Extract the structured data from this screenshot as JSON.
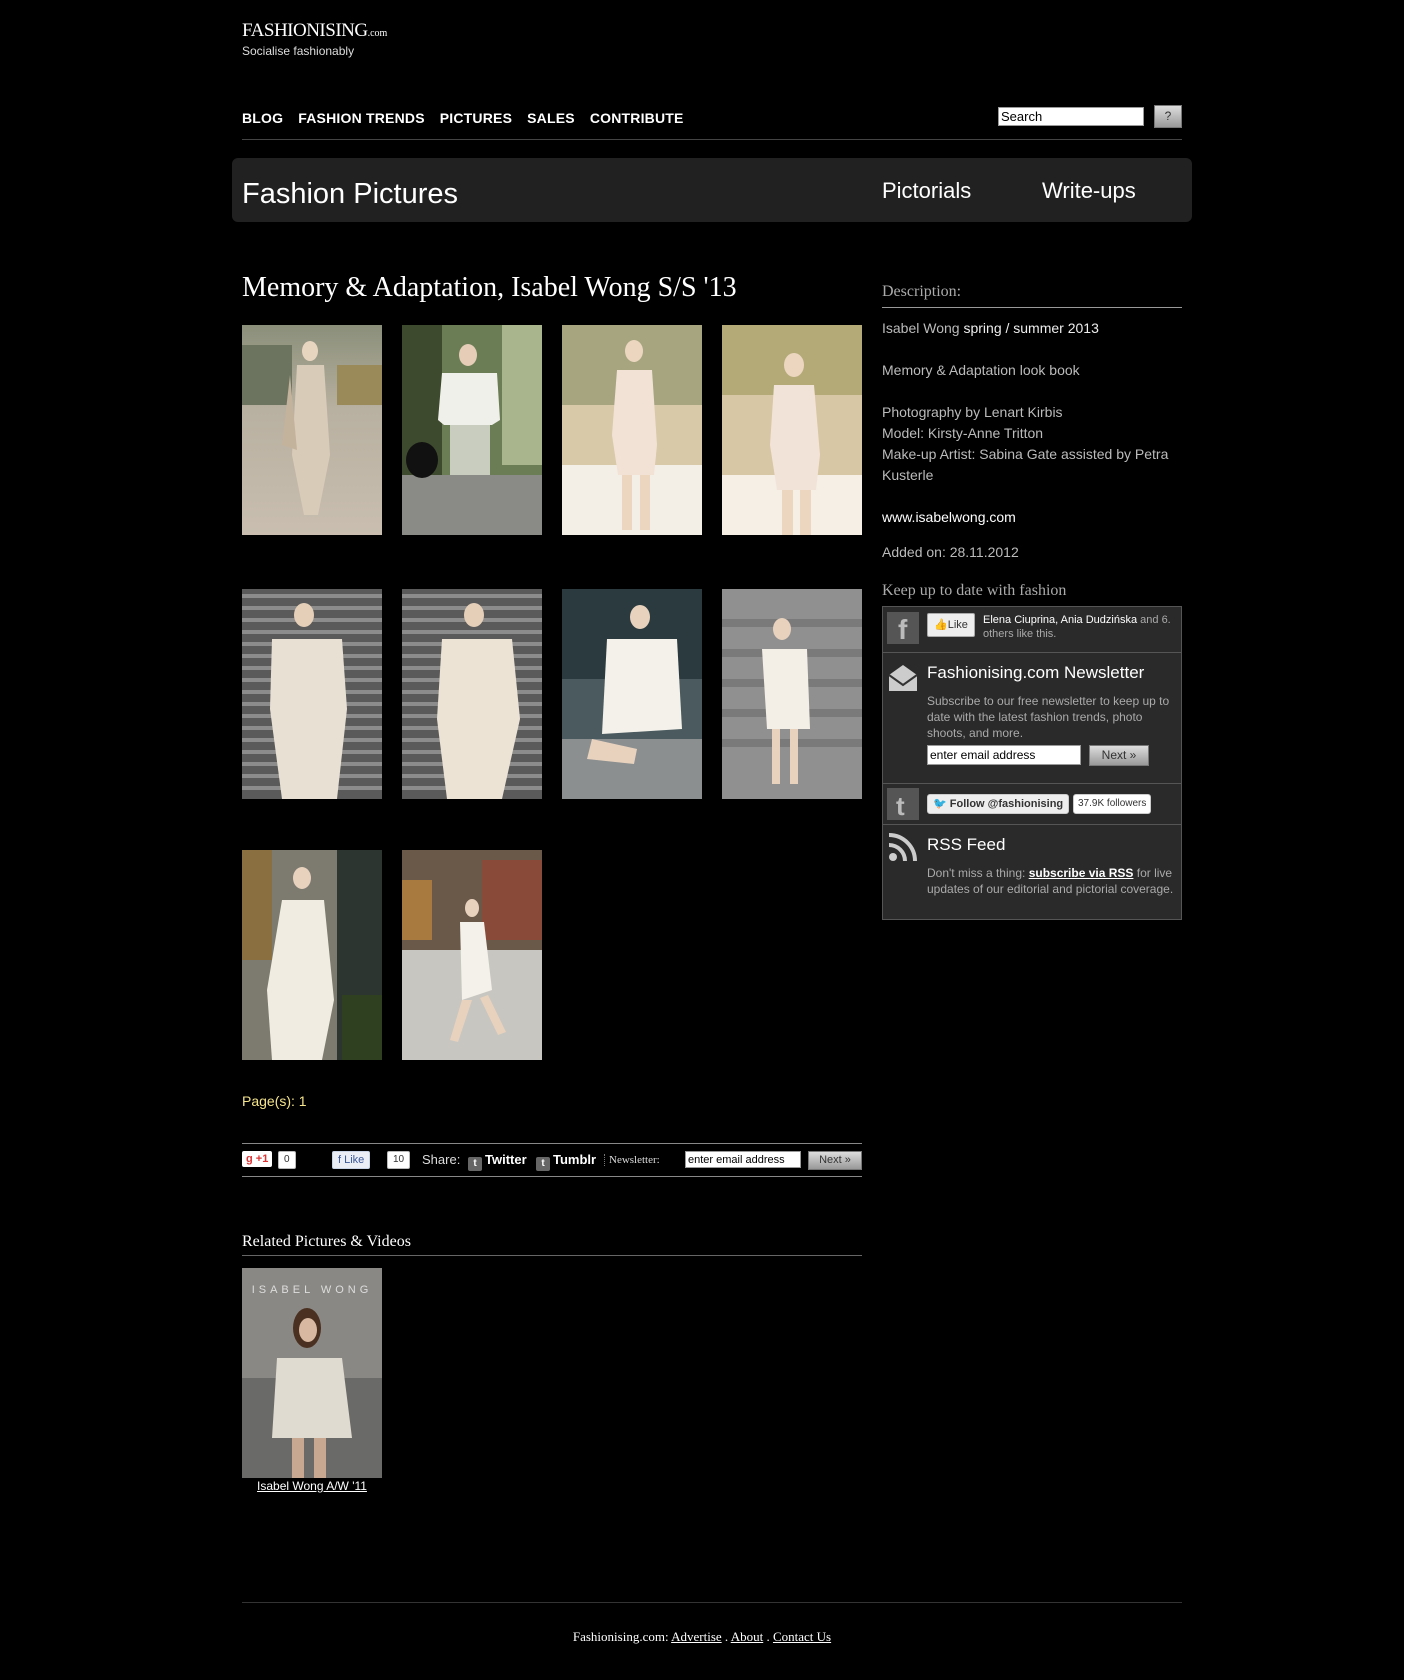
{
  "header": {
    "brand": "FASHIONISING",
    "brand_suffix": ".com",
    "tagline": "Socialise fashionably",
    "nav": [
      "BLOG",
      "FASHION TRENDS",
      "PICTURES",
      "SALES",
      "CONTRIBUTE"
    ],
    "search_value": "Search",
    "search_button": "?"
  },
  "banner": {
    "title": "Fashion Pictures",
    "links": [
      "Pictorials",
      "Write-ups"
    ]
  },
  "main": {
    "title": "Memory & Adaptation, Isabel Wong S/S '13",
    "photos_count": 10,
    "pages": "Page(s): 1"
  },
  "sharebar": {
    "gplus": "+1",
    "gplus_count": "0",
    "fb_like": "Like",
    "fb_count": "10",
    "share_label": "Share:",
    "twitter": "Twitter",
    "tumblr": "Tumblr",
    "newsletter_label": "Newsletter:",
    "email_placeholder": "enter email address",
    "next": "Next »"
  },
  "related": {
    "title": "Related Pictures & Videos",
    "items": [
      {
        "caption": "Isabel Wong A/W '11",
        "cover_text": "ISABEL WONG"
      }
    ]
  },
  "sidebar": {
    "description_label": "Description:",
    "line1_a": "Isabel Wong",
    "line1_b": "spring / summer 2013",
    "line2": "Memory & Adaptation look book",
    "line3": "Photography by Lenart Kirbis",
    "line4": "Model: Kirsty-Anne Tritton",
    "line5": "Make-up Artist: Sabina Gate assisted by Petra Kusterle",
    "website": "www.isabelwong.com",
    "added": "Added on: 28.11.2012",
    "keep_up": "Keep up to date with fashion",
    "fb_like_btn": "Like",
    "fb_names": "Elena Ciuprina, Ania Dudzińska",
    "fb_rest": "and 6.",
    "fb_rest2": "others like this.",
    "newsletter_title": "Fashionising.com Newsletter",
    "newsletter_text": "Subscribe to our free newsletter to keep up to date with the latest fashion trends, photo shoots, and more.",
    "newsletter_placeholder": "enter email address",
    "newsletter_next": "Next »",
    "twitter_follow": "Follow @fashionising",
    "twitter_followers": "37.9K followers",
    "rss_title": "RSS Feed",
    "rss_text_a": "Don't miss a thing:",
    "rss_link": "subscribe via RSS",
    "rss_text_b": "for live updates of our editorial and pictorial coverage."
  },
  "footer": {
    "site": "Fashionising.com:",
    "links": [
      "Advertise",
      "About",
      "Contact Us"
    ]
  }
}
